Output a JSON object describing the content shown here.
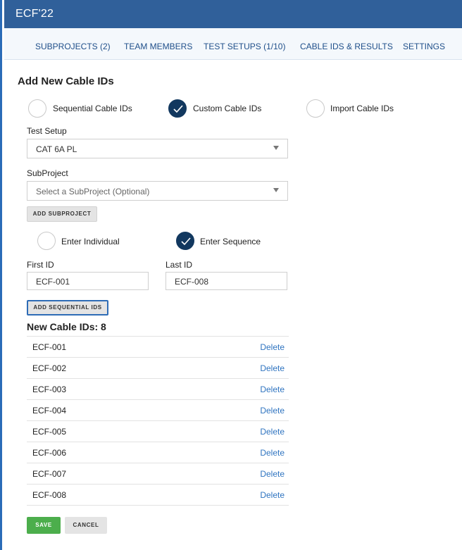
{
  "app": {
    "title": "ECF'22"
  },
  "nav": {
    "tabs": [
      {
        "label": "SUBPROJECTS (2)"
      },
      {
        "label": "TEAM MEMBERS"
      },
      {
        "label": "TEST SETUPS (1/10)"
      },
      {
        "label": "CABLE IDS & RESULTS"
      },
      {
        "label": "SETTINGS"
      }
    ]
  },
  "form": {
    "heading": "Add New Cable IDs",
    "mode_options": [
      {
        "label": "Sequential Cable IDs",
        "checked": false
      },
      {
        "label": "Custom Cable IDs",
        "checked": true
      },
      {
        "label": "Import Cable IDs",
        "checked": false
      }
    ],
    "test_setup": {
      "label": "Test Setup",
      "value": "CAT 6A PL"
    },
    "subproject": {
      "label": "SubProject",
      "placeholder": "Select a SubProject (Optional)"
    },
    "add_subproject_label": "ADD SUBPROJECT",
    "entry_options": [
      {
        "label": "Enter Individual",
        "checked": false
      },
      {
        "label": "Enter Sequence",
        "checked": true
      }
    ],
    "first_id": {
      "label": "First ID",
      "value": "ECF-001"
    },
    "last_id": {
      "label": "Last ID",
      "value": "ECF-008"
    },
    "add_sequential_label": "ADD SEQUENTIAL IDS",
    "new_count_label": "New Cable IDs: 8",
    "delete_label": "Delete",
    "cable_ids": [
      "ECF-001",
      "ECF-002",
      "ECF-003",
      "ECF-004",
      "ECF-005",
      "ECF-006",
      "ECF-007",
      "ECF-008"
    ],
    "save_label": "SAVE",
    "cancel_label": "CANCEL"
  },
  "colors": {
    "header": "#30609a",
    "nav_text": "#1f4f8a",
    "radio_checked": "#12385f",
    "link": "#2f74c0",
    "save": "#4cae4c"
  }
}
